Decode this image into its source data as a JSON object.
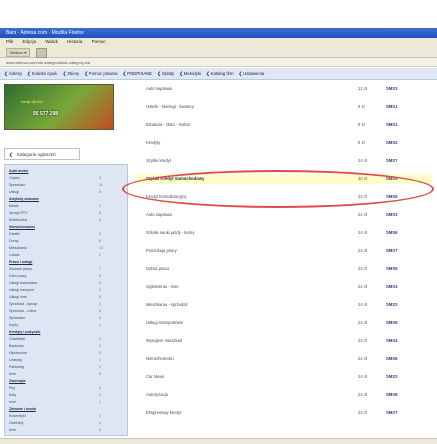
{
  "window": {
    "title": "Bars · Adresa com · Mozilla Firefox"
  },
  "menu": [
    "Plik",
    "Edycja",
    "Widok",
    "Historia",
    "Pomoc"
  ],
  "toolbar": {
    "back_label": "Wstecz",
    "dropdown": "▾"
  },
  "address": "www.adresa.com/ntu-kategoria/kat-category-list",
  "sitenav": [
    "Adresy",
    "Kodeks cywil.",
    "Zbiory",
    "Pomoc prawna",
    "PODPISANE",
    "Opłaty",
    "Metodyki",
    "Katalog firm",
    "Ustawienia"
  ],
  "banner": {
    "amount": "95 577 298",
    "caption": "kredyt dla firm"
  },
  "sidebar": {
    "header": "Kategorie ogłoszeń",
    "rows": [
      {
        "label": "Auto motor",
        "count": "",
        "cat": true
      },
      {
        "label": "Części",
        "count": "3"
      },
      {
        "label": "Sprzedam",
        "count": "11"
      },
      {
        "label": "Usługi",
        "count": "5"
      },
      {
        "label": "Artykuły domowe",
        "count": "",
        "cat": true
      },
      {
        "label": "Meble",
        "count": "2"
      },
      {
        "label": "Sprzęt RTV",
        "count": "8"
      },
      {
        "label": "Elektronika",
        "count": "4"
      },
      {
        "label": "Nieruchomości",
        "count": "",
        "cat": true
      },
      {
        "label": "Działki",
        "count": "3"
      },
      {
        "label": "Domy",
        "count": "6"
      },
      {
        "label": "Mieszkania",
        "count": "14"
      },
      {
        "label": "Lokale",
        "count": "2"
      },
      {
        "label": "Praca i usługi",
        "count": "",
        "cat": true
      },
      {
        "label": "Szukam pracy",
        "count": "7"
      },
      {
        "label": "Dam pracę",
        "count": "9"
      },
      {
        "label": "Usługi budowlane",
        "count": "4"
      },
      {
        "label": "Usługi transport",
        "count": "3"
      },
      {
        "label": "Usługi inne",
        "count": "5"
      },
      {
        "label": "Sprzedaż - sprzęt",
        "count": "2"
      },
      {
        "label": "Sprzedaż - różne",
        "count": "6"
      },
      {
        "label": "Sprzedam",
        "count": "3"
      },
      {
        "label": "Kupię",
        "count": "1"
      },
      {
        "label": "Kredyty i pożyczki",
        "count": "",
        "cat": true
      },
      {
        "label": "Chwilówki",
        "count": "2"
      },
      {
        "label": "Bankowe",
        "count": "4"
      },
      {
        "label": "Hipoteczne",
        "count": "3"
      },
      {
        "label": "Leasing",
        "count": "1"
      },
      {
        "label": "Faktoring",
        "count": "2"
      },
      {
        "label": "Inne",
        "count": "5"
      },
      {
        "label": "Zwierzęta",
        "count": "",
        "cat": true
      },
      {
        "label": "Psy",
        "count": "3"
      },
      {
        "label": "Koty",
        "count": "2"
      },
      {
        "label": "Inne",
        "count": "1"
      },
      {
        "label": "Zdrowie i uroda",
        "count": "",
        "cat": true
      },
      {
        "label": "Kosmetyki",
        "count": "2"
      },
      {
        "label": "Gabinety",
        "count": "1"
      },
      {
        "label": "Inne",
        "count": "3"
      }
    ]
  },
  "table": {
    "rows": [
      {
        "name": "Auto naprawa",
        "val": "12 zł",
        "code": "SMS3"
      },
      {
        "name": "Hotele - Noclegi - kwatery",
        "val": "9 zł",
        "code": "SMS1"
      },
      {
        "name": "Biżuteria - złoto - srebro",
        "val": "9 zł",
        "code": "SMS1"
      },
      {
        "name": "Kredyty",
        "val": "9 zł",
        "code": "SMS2"
      },
      {
        "name": "Szybki kredyt",
        "val": "24 zł",
        "code": "SMS7"
      },
      {
        "name": "Szybki Kredyt Samochodowy",
        "val": "30 zł",
        "code": "SMS4",
        "highlight": true
      },
      {
        "name": "Kredyt konsolidacyjny",
        "val": "24 zł",
        "code": "SMS6"
      },
      {
        "name": "Auto naprawa",
        "val": "24 zł",
        "code": "SMS3"
      },
      {
        "name": "Szkoła nauki jazdy - kursy",
        "val": "24 zł",
        "code": "SMS6"
      },
      {
        "name": "Poszukuję pracy",
        "val": "24 zł",
        "code": "SMS7"
      },
      {
        "name": "Dobra praca",
        "val": "24 zł",
        "code": "SMS5"
      },
      {
        "name": "Ogłoszenia - inne",
        "val": "24 zł",
        "code": "SMS4"
      },
      {
        "name": "Mieszkania - sprzedaż",
        "val": "24 zł",
        "code": "SMS2"
      },
      {
        "name": "Usługi transportowe",
        "val": "24 zł",
        "code": "SMS6"
      },
      {
        "name": "Wynajem mieszkań",
        "val": "24 zł",
        "code": "SMS4"
      },
      {
        "name": "Nieruchomości",
        "val": "24 zł",
        "code": "SMS6"
      },
      {
        "name": "Car News",
        "val": "24 zł",
        "code": "SMS2"
      },
      {
        "name": "Autoryzacja",
        "val": "24 zł",
        "code": "SMS8"
      },
      {
        "name": "Ekspresowy kredyt",
        "val": "24 zł",
        "code": "SMS7"
      }
    ]
  }
}
